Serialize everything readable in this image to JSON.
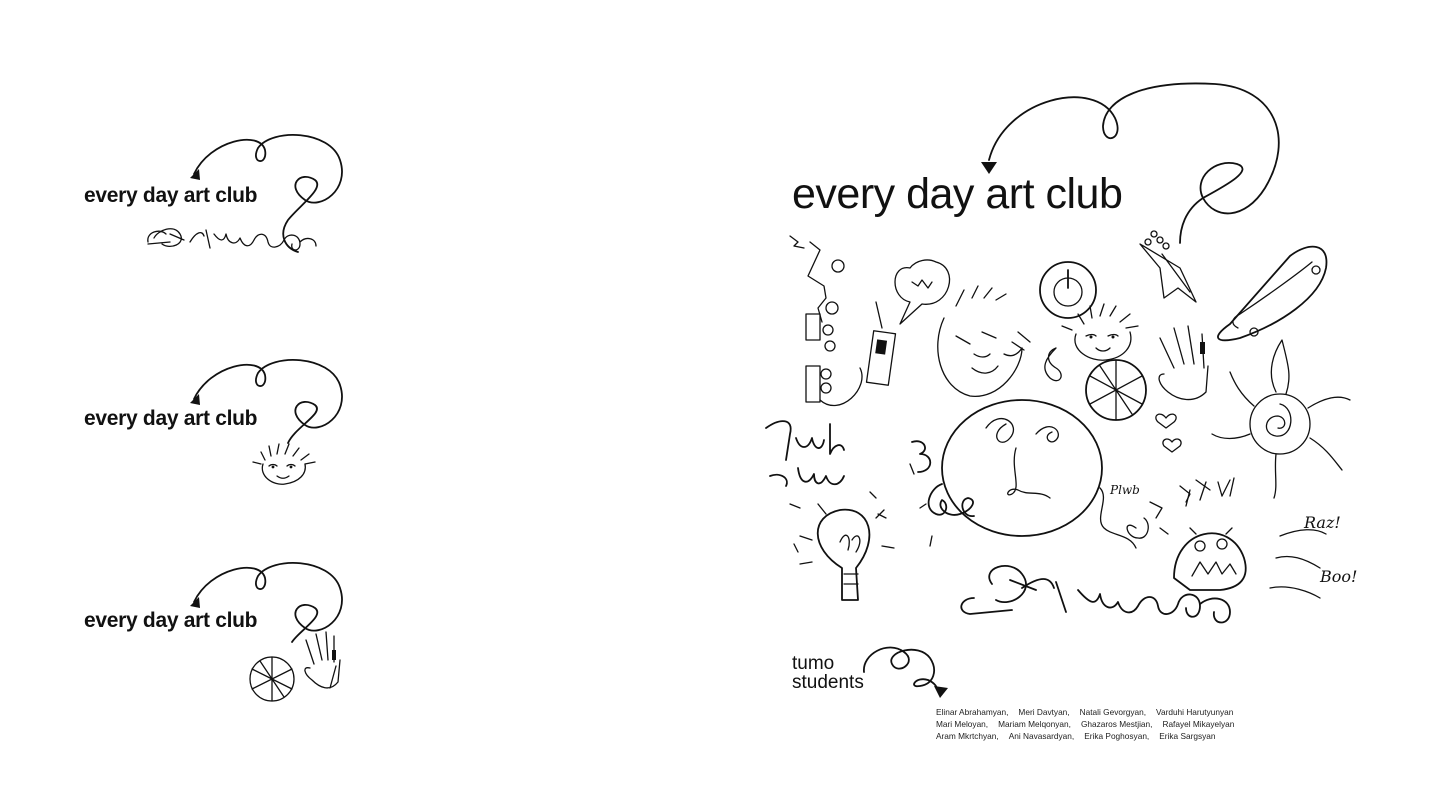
{
  "logo_variants": [
    {
      "title": "every day art club",
      "doodle": "tumo-signature"
    },
    {
      "title": "every day art club",
      "doodle": "spiky-hair-face"
    },
    {
      "title": "every day art club",
      "doodle": "ball-and-hand"
    }
  ],
  "poster": {
    "title": "every day art club",
    "tumo_line1": "tumo",
    "tumo_line2": "students",
    "doodle_words": {
      "raz": "Raz!",
      "boo": "Boo!"
    }
  },
  "credits": {
    "row1": [
      "Elinar Abrahamyan,",
      "Meri Davtyan,",
      "Natali Gevorgyan,",
      "Varduhi Harutyunyan"
    ],
    "row2": [
      "Mari Meloyan,",
      "Mariam Melqonyan,",
      "Ghazaros Mestjian,",
      "Rafayel Mikayelyan"
    ],
    "row3": [
      "Aram Mkrtchyan,",
      "Ani Navasardyan,",
      "Erika Poghosyan,",
      "Erika Sargsyan"
    ]
  },
  "colors": {
    "ink": "#111111",
    "background": "#ffffff"
  },
  "icons": [
    "curly-arrow-icon",
    "face-icon",
    "ball-icon",
    "hand-icon",
    "lightbulb-icon",
    "phone-icon",
    "power-icon",
    "sun-icon",
    "skateboard-icon",
    "monster-icon",
    "heart-icon"
  ]
}
